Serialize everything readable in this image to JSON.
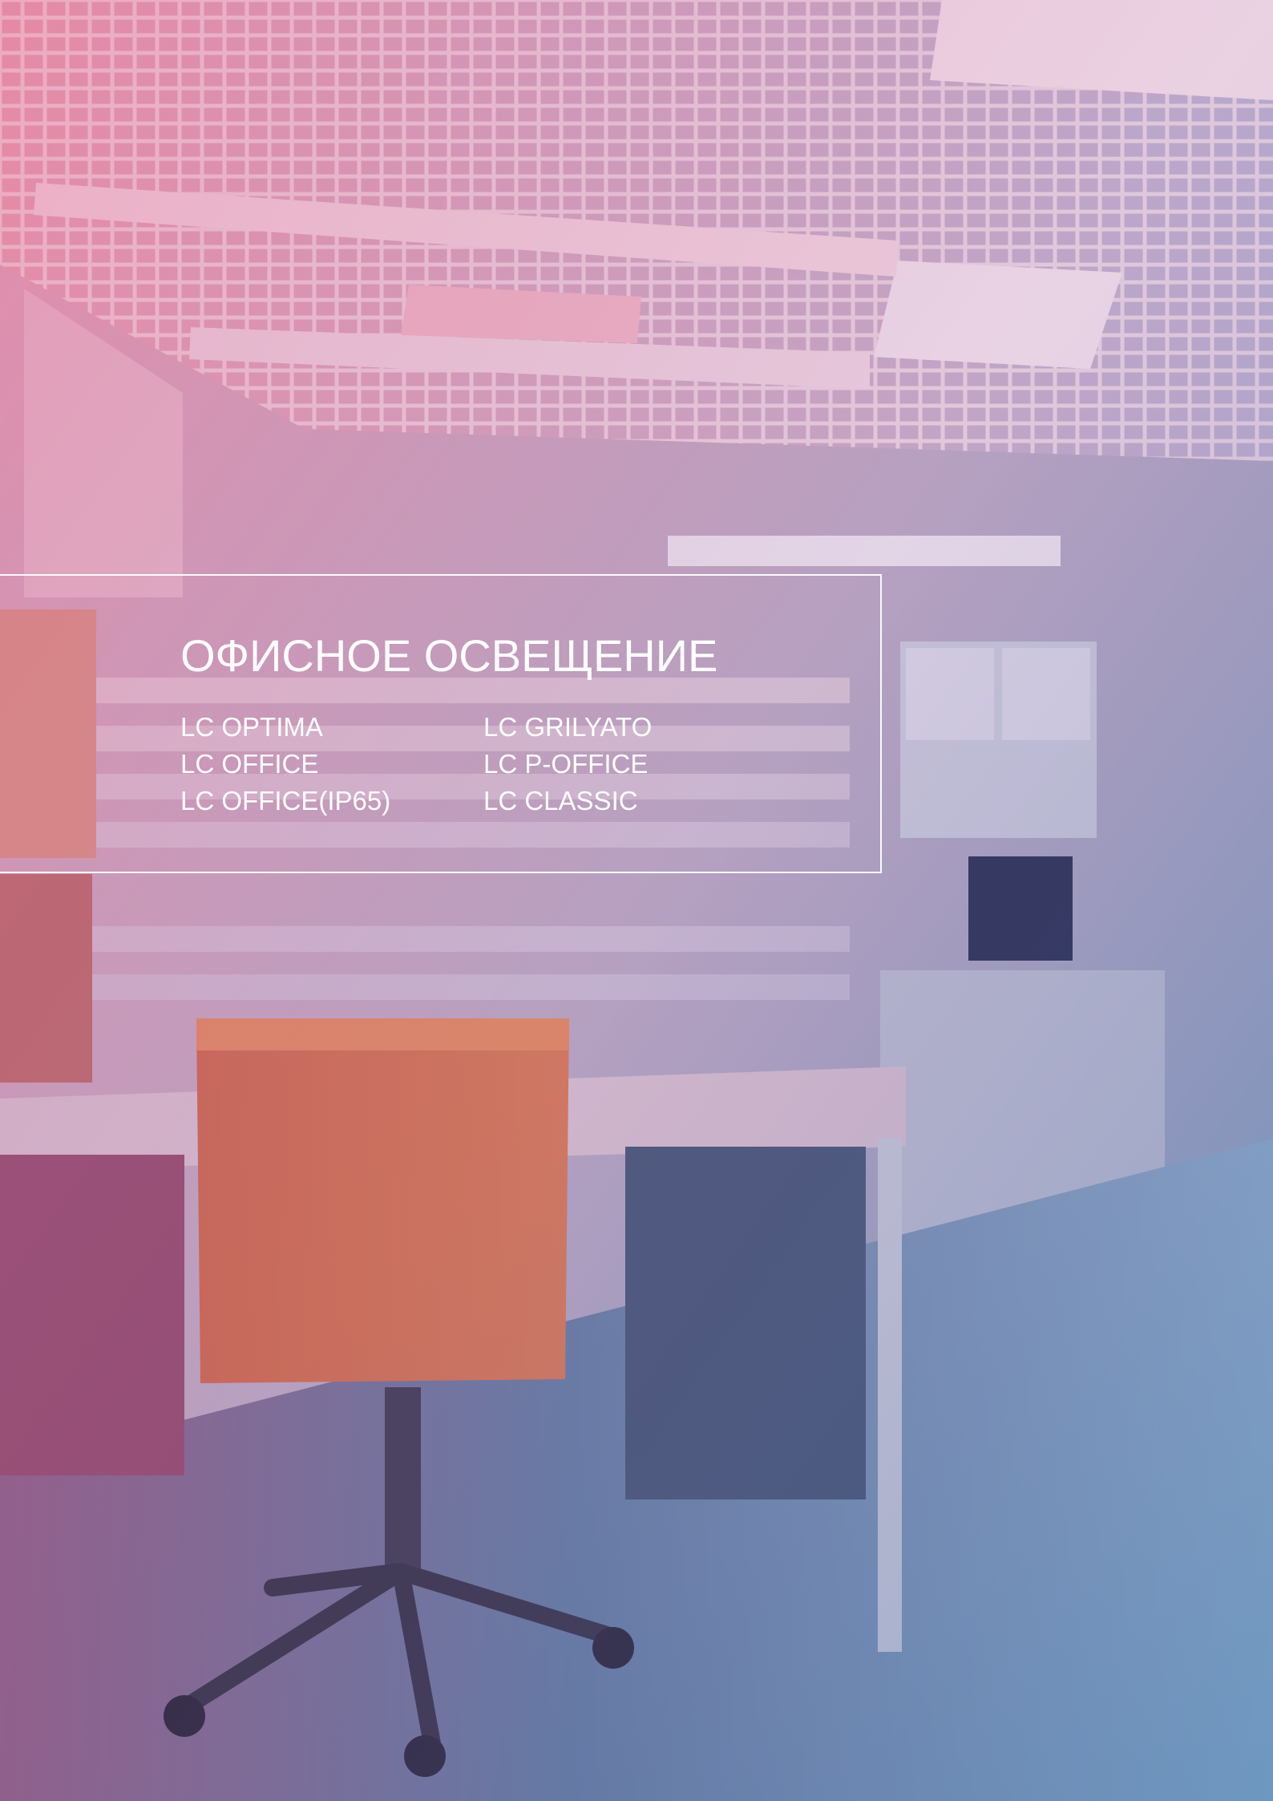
{
  "title": "ОФИСНОЕ ОСВЕЩЕНИЕ",
  "products_left": [
    "LC OPTIMA",
    "LC OFFICE",
    "LC OFFICE(IP65)"
  ],
  "products_right": [
    "LC GRILYATO",
    "LC P-OFFICE",
    "LC CLASSIC"
  ],
  "colors": {
    "gradient_pink": "#d86a8e",
    "gradient_blue": "#3f78a8",
    "text": "#ffffff"
  }
}
